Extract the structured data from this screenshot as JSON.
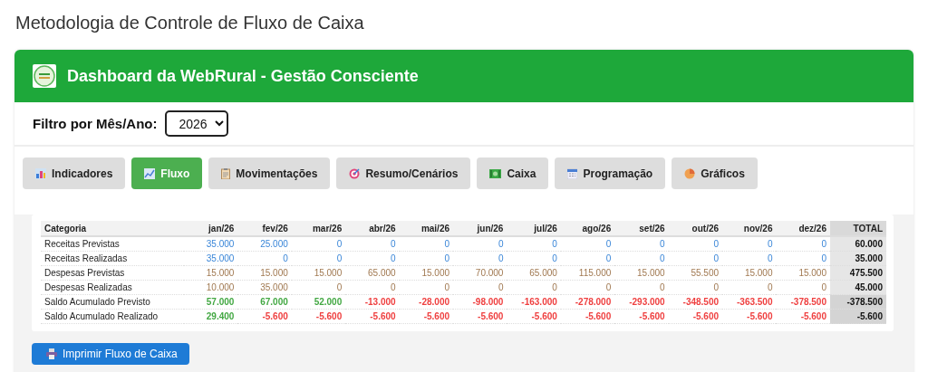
{
  "page_title": "Metodologia de Controle de Fluxo de Caixa",
  "header": {
    "title": "Dashboard da WebRural - Gestão Consciente"
  },
  "filter": {
    "label": "Filtro por Mês/Ano:",
    "value": "2026"
  },
  "tabs": [
    {
      "label": "Indicadores",
      "selected": false
    },
    {
      "label": "Fluxo",
      "selected": true
    },
    {
      "label": "Movimentações",
      "selected": false
    },
    {
      "label": "Resumo/Cenários",
      "selected": false
    },
    {
      "label": "Caixa",
      "selected": false
    },
    {
      "label": "Programação",
      "selected": false
    },
    {
      "label": "Gráficos",
      "selected": false
    }
  ],
  "table": {
    "columns": [
      "Categoria",
      "jan/26",
      "fev/26",
      "mar/26",
      "abr/26",
      "mai/26",
      "jun/26",
      "jul/26",
      "ago/26",
      "set/26",
      "out/26",
      "nov/26",
      "dez/26",
      "TOTAL"
    ],
    "rows": [
      {
        "category": "Receitas Previstas",
        "kind": "receita",
        "values": [
          "35.000",
          "25.000",
          "0",
          "0",
          "0",
          "0",
          "0",
          "0",
          "0",
          "0",
          "0",
          "0"
        ],
        "total": "60.000"
      },
      {
        "category": "Receitas Realizadas",
        "kind": "receita",
        "values": [
          "35.000",
          "0",
          "0",
          "0",
          "0",
          "0",
          "0",
          "0",
          "0",
          "0",
          "0",
          "0"
        ],
        "total": "35.000"
      },
      {
        "category": "Despesas Previstas",
        "kind": "despesa",
        "values": [
          "15.000",
          "15.000",
          "15.000",
          "65.000",
          "15.000",
          "70.000",
          "65.000",
          "115.000",
          "15.000",
          "55.500",
          "15.000",
          "15.000"
        ],
        "total": "475.500"
      },
      {
        "category": "Despesas Realizadas",
        "kind": "despesa",
        "values": [
          "10.000",
          "35.000",
          "0",
          "0",
          "0",
          "0",
          "0",
          "0",
          "0",
          "0",
          "0",
          "0"
        ],
        "total": "45.000"
      },
      {
        "category": "Saldo Acumulado Previsto",
        "kind": "saldo",
        "values": [
          {
            "text": "57.000",
            "negative": false
          },
          {
            "text": "67.000",
            "negative": false
          },
          {
            "text": "52.000",
            "negative": false
          },
          {
            "text": "-13.000",
            "negative": true
          },
          {
            "text": "-28.000",
            "negative": true
          },
          {
            "text": "-98.000",
            "negative": true
          },
          {
            "text": "-163.000",
            "negative": true
          },
          {
            "text": "-278.000",
            "negative": true
          },
          {
            "text": "-293.000",
            "negative": true
          },
          {
            "text": "-348.500",
            "negative": true
          },
          {
            "text": "-363.500",
            "negative": true
          },
          {
            "text": "-378.500",
            "negative": true
          }
        ],
        "total": "-378.500"
      },
      {
        "category": "Saldo Acumulado Realizado",
        "kind": "saldo",
        "values": [
          {
            "text": "29.400",
            "negative": false
          },
          {
            "text": "-5.600",
            "negative": true
          },
          {
            "text": "-5.600",
            "negative": true
          },
          {
            "text": "-5.600",
            "negative": true
          },
          {
            "text": "-5.600",
            "negative": true
          },
          {
            "text": "-5.600",
            "negative": true
          },
          {
            "text": "-5.600",
            "negative": true
          },
          {
            "text": "-5.600",
            "negative": true
          },
          {
            "text": "-5.600",
            "negative": true
          },
          {
            "text": "-5.600",
            "negative": true
          },
          {
            "text": "-5.600",
            "negative": true
          },
          {
            "text": "-5.600",
            "negative": true
          }
        ],
        "total": "-5.600"
      }
    ]
  },
  "print_button": {
    "label": "Imprimir Fluxo de Caixa"
  }
}
